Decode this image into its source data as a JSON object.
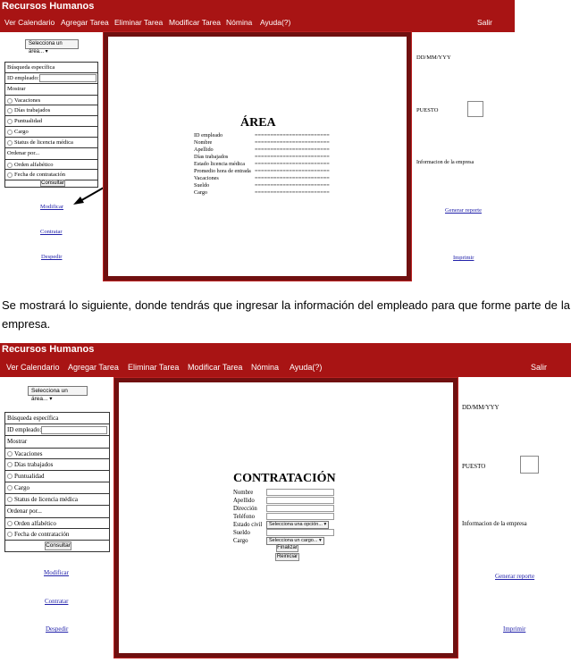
{
  "screen1": {
    "app_title": "Recursos Humanos",
    "nav": [
      "Ver Calendario",
      "Agregar Tarea",
      "Eliminar Tarea",
      "Modificar Tarea",
      "Nómina",
      "Ayuda(?)"
    ],
    "logout": "Salir",
    "area_select": "Selecciona un área...",
    "filters": {
      "specific_search": "Búsqueda específica",
      "employee_id": "ID empleado:",
      "show": "Mostrar",
      "options": [
        "Vacaciones",
        "Días trabajados",
        "Puntualidad",
        "Cargo",
        "Status de licencia médica"
      ],
      "order_by": "Ordenar por...",
      "order_options": [
        "Orden alfabético",
        "Fecha de contratación"
      ],
      "submit": "Consultar"
    },
    "actions": [
      "Modificar",
      "Contratar",
      "Despedir"
    ],
    "panel_title": "ÁREA",
    "fields": [
      {
        "label": "ID empleado",
        "value": "========================"
      },
      {
        "label": "Nombre",
        "value": "========================"
      },
      {
        "label": "Apellido",
        "value": "========================"
      },
      {
        "label": "Días trabajados",
        "value": "========================"
      },
      {
        "label": "Estado licencia médica",
        "value": "========================"
      },
      {
        "label": "Promedio hora de entrada",
        "value": "========================"
      },
      {
        "label": "Vacaciones",
        "value": "========================"
      },
      {
        "label": "Sueldo",
        "value": "========================"
      },
      {
        "label": "Cargo",
        "value": "========================"
      }
    ],
    "right": {
      "date": "DD/MM/YYY",
      "position": "PUESTO",
      "company_info": "Informacion de la empresa",
      "report": "Generar reporte",
      "print": "Imprimir"
    }
  },
  "caption": "Se mostrará lo siguiente, donde tendrás que ingresar la información del empleado para que forme parte de la empresa.",
  "screen2": {
    "app_title": "Recursos Humanos",
    "nav": [
      "Ver Calendario",
      "Agregar Tarea",
      "Eliminar Tarea",
      "Modificar Tarea",
      "Nómina",
      "Ayuda(?)"
    ],
    "logout": "Salir",
    "area_select": "Selecciona un área...",
    "filters": {
      "specific_search": "Búsqueda específica",
      "employee_id": "ID empleado:",
      "show": "Mostrar",
      "options": [
        "Vacaciones",
        "Días trabajados",
        "Puntualidad",
        "Cargo",
        "Status de licencia médica"
      ],
      "order_by": "Ordenar por...",
      "order_options": [
        "Orden alfabético",
        "Fecha de contratación"
      ],
      "submit": "Consultar"
    },
    "actions": [
      "Modificar",
      "Contratar",
      "Despedir"
    ],
    "panel_title": "CONTRATACIÓN",
    "form": {
      "name": "Nombre",
      "surname": "Apellido",
      "address": "Dirección",
      "phone": "Teléfono",
      "civil_status": "Estado civil",
      "civil_status_select": "Selecciona una opción...",
      "salary": "Sueldo",
      "position": "Cargo",
      "position_select": "Selecciona un cargo...",
      "finish": "Finalizar",
      "reset": "Reiniciar"
    },
    "right": {
      "date": "DD/MM/YYY",
      "position": "PUESTO",
      "company_info": "Informacion de la empresa",
      "report": "Generar reporte",
      "print": "Imprimir"
    }
  }
}
